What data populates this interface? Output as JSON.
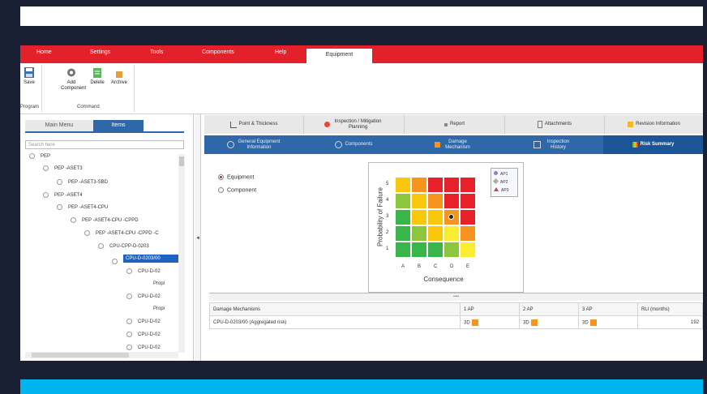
{
  "menu": {
    "items": [
      "Home",
      "Settings",
      "Tools",
      "Components",
      "Help"
    ],
    "active": "Equipment"
  },
  "ribbon": {
    "save": "Save",
    "add_component": "Add Component",
    "delete": "Delete",
    "archive": "Archive",
    "group_program": "Program",
    "group_command": "Command"
  },
  "left": {
    "tab_main": "Main Menu",
    "tab_items": "Items",
    "search_placeholder": "Search here",
    "tree": [
      "PEP",
      "PEP -ASET3",
      "PEP -ASET3-SBD",
      "PEP -ASET4",
      "PEP -ASET4-CPU",
      "PEP -ASET4-CPU -CPPD",
      "PEP -ASET4-CPU -CPPD -C",
      "CPU-CPP-D-0203",
      "CPU-D-0203/00",
      "CPU-D-02",
      "Propi",
      "CPU-D-02",
      "Propi",
      "CPU-D-02",
      "CPU-D-02",
      "CPU-D-02"
    ]
  },
  "tabs_row1": [
    "Point & Thickness",
    "Inspection / Mitigation Planning",
    "Report",
    "Attachments",
    "Revision Information"
  ],
  "tabs_row2": [
    "General Equipment Information",
    "Components",
    "Damage Mechanism",
    "Inspection History",
    "Risk Summary"
  ],
  "options": {
    "equipment": "Equipment",
    "component": "Component"
  },
  "matrix": {
    "ylabel": "Probability of Failure",
    "xlabel": "Consequence",
    "rows": [
      "5",
      "4",
      "3",
      "2",
      "1"
    ],
    "cols": [
      "A",
      "B",
      "C",
      "D",
      "E"
    ],
    "colors": [
      [
        "#f9c80e",
        "#f7941d",
        "#e8202a",
        "#e8202a",
        "#e8202a"
      ],
      [
        "#8cc63f",
        "#f9c80e",
        "#f7941d",
        "#e8202a",
        "#e8202a"
      ],
      [
        "#39b54a",
        "#f9c80e",
        "#f9c80e",
        "#f7941d",
        "#e8202a"
      ],
      [
        "#39b54a",
        "#8cc63f",
        "#f9c80e",
        "#f9ec31",
        "#f7941d"
      ],
      [
        "#39b54a",
        "#39b54a",
        "#39b54a",
        "#8cc63f",
        "#f9ec31"
      ]
    ],
    "legend": [
      "AP1",
      "AP2",
      "AP3"
    ],
    "marker": {
      "row": "3",
      "col": "D"
    }
  },
  "grid": {
    "headers": [
      "Damage Mechanisms",
      "1 AP",
      "2 AP",
      "3 AP",
      "RLI (months)"
    ],
    "row": {
      "name": "CPU-D-0203/00 (Aggregated risk)",
      "ap1": "3D",
      "ap2": "3D",
      "ap3": "3D",
      "rli": "192"
    }
  }
}
